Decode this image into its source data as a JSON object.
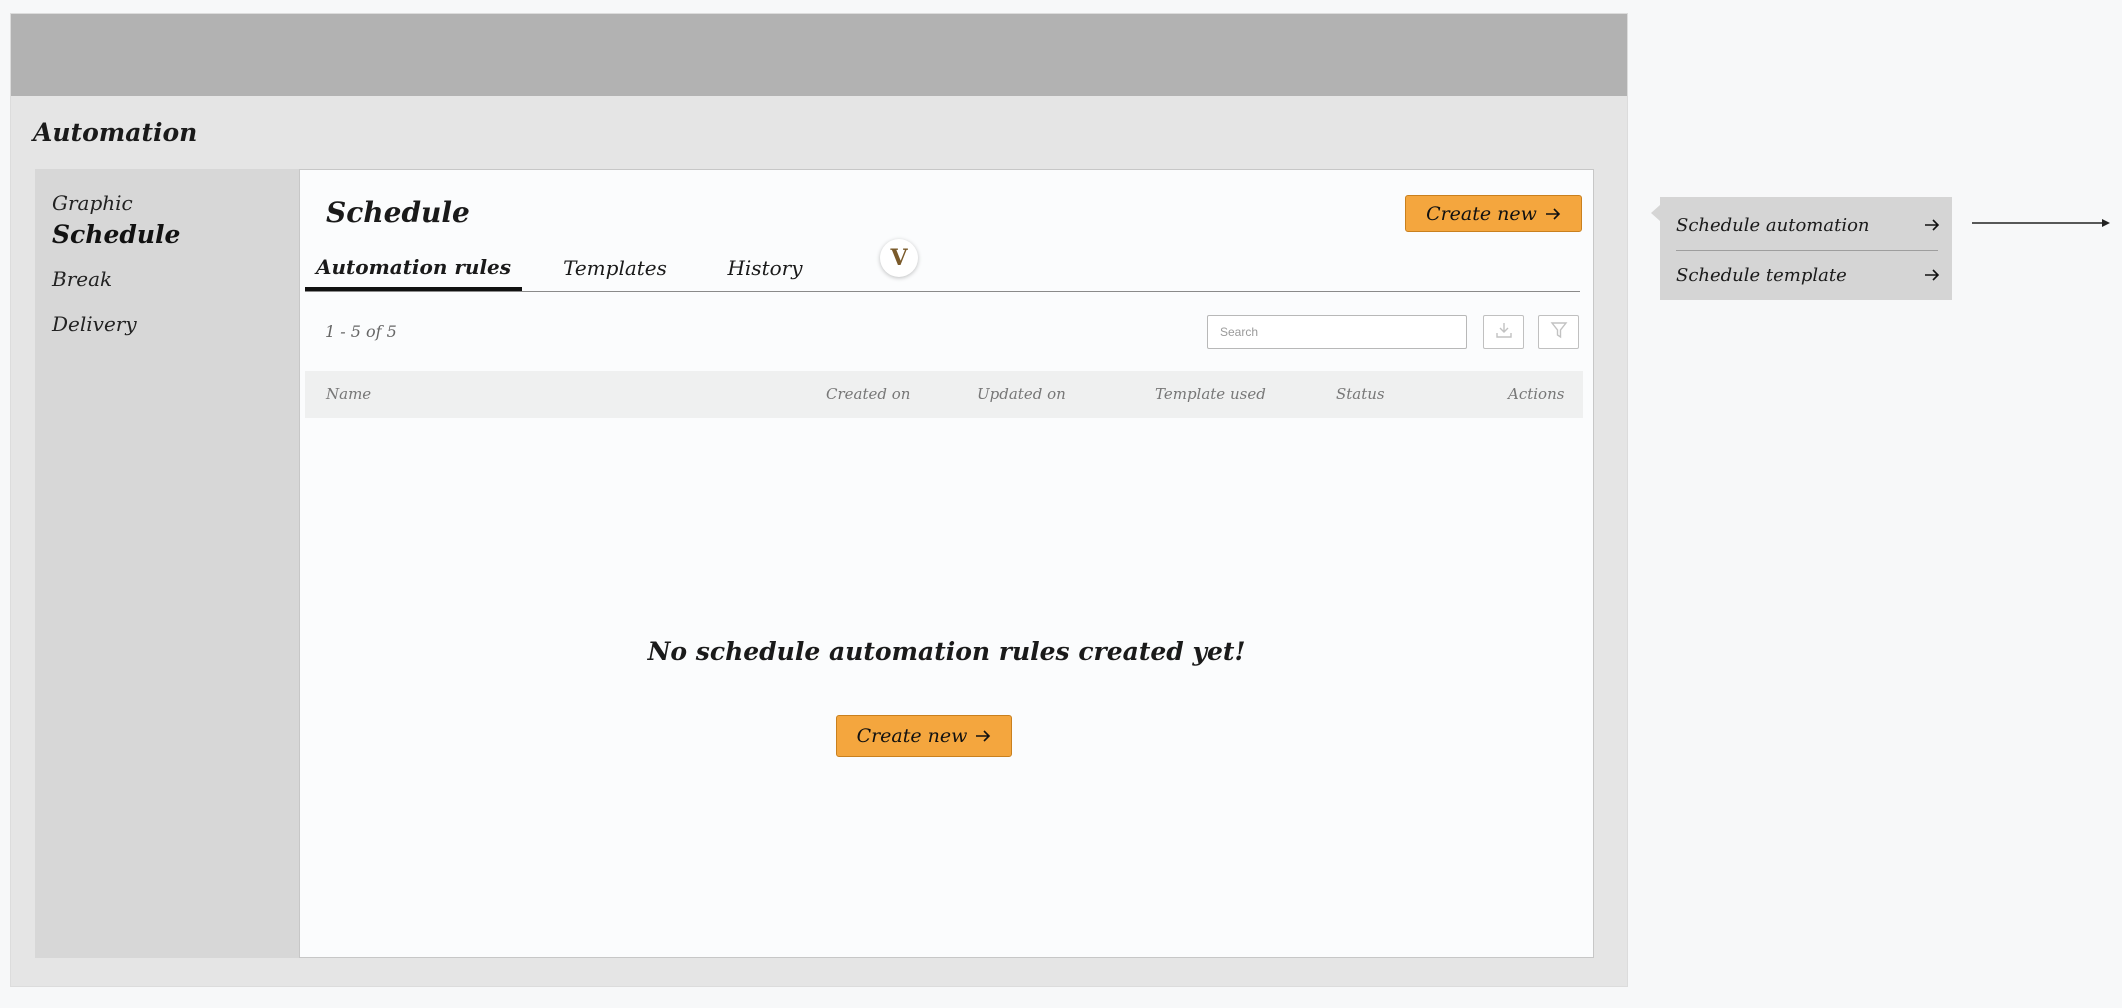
{
  "app": {
    "title": "Automation"
  },
  "sidebar": {
    "items": [
      {
        "label": "Graphic",
        "active": false
      },
      {
        "label": "Schedule",
        "active": true
      },
      {
        "label": "Break",
        "active": false
      },
      {
        "label": "Delivery",
        "active": false
      }
    ]
  },
  "main": {
    "title": "Schedule",
    "create_button": {
      "label": "Create new",
      "icon": "arrow-right-icon"
    },
    "tabs": [
      {
        "label": "Automation rules",
        "active": true
      },
      {
        "label": "Templates",
        "active": false
      },
      {
        "label": "History",
        "active": false
      }
    ],
    "tab_badge": {
      "text": "V"
    },
    "count_text": "1 - 5 of 5",
    "search": {
      "placeholder": "Search",
      "value": ""
    },
    "toolbar_icons": [
      "download-icon",
      "filter-icon"
    ],
    "table": {
      "columns": [
        "Name",
        "Created on",
        "Updated on",
        "Template used",
        "Status",
        "Actions"
      ],
      "rows": []
    },
    "empty_state": {
      "message": "No schedule automation rules created yet!",
      "button_label": "Create new"
    }
  },
  "dropdown": {
    "items": [
      {
        "label": "Schedule automation",
        "icon": "arrow-right-icon"
      },
      {
        "label": "Schedule template",
        "icon": "arrow-right-icon"
      }
    ]
  },
  "colors": {
    "accent": "#f4a63e",
    "accent_border": "#c9801e",
    "topbar": "#b2b2b2",
    "frame": "#e5e5e5",
    "sidebar": "#d7d7d7",
    "panel": "#fbfcfd",
    "dropdown": "#d5d5d5"
  }
}
